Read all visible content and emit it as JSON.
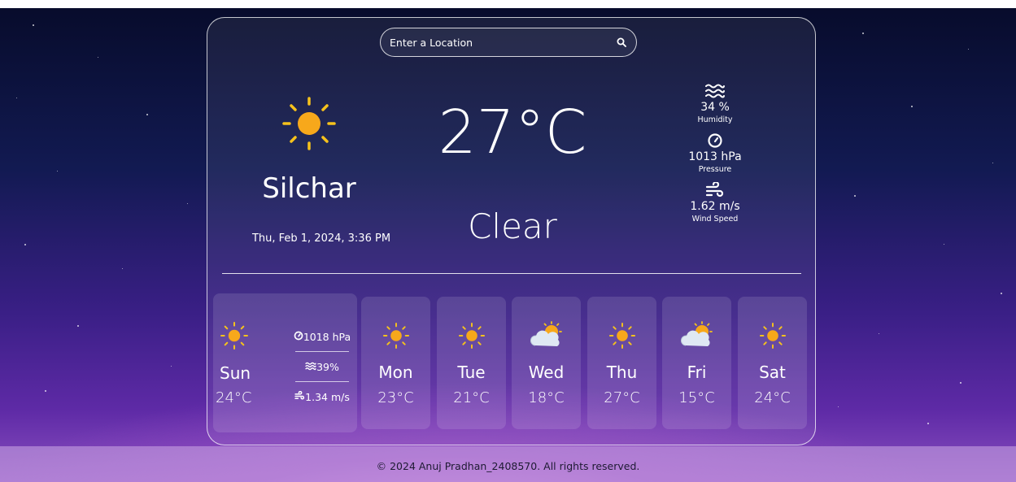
{
  "search": {
    "placeholder": "Enter a Location"
  },
  "current": {
    "city": "Silchar",
    "datetime": "Thu, Feb 1, 2024, 3:36 PM",
    "temperature": "27°C",
    "condition": "Clear",
    "icon": "sun-icon"
  },
  "stats": {
    "humidity": {
      "value": "34 %",
      "label": "Humidity",
      "icon": "humidity-icon"
    },
    "pressure": {
      "value": "1013 hPa",
      "label": "Pressure",
      "icon": "pressure-gauge-icon"
    },
    "wind": {
      "value": "1.62 m/s",
      "label": "Wind Speed",
      "icon": "wind-icon"
    }
  },
  "today": {
    "day": "Sun",
    "temp": "24°C",
    "pressure": "1018 hPa",
    "humidity": "39%",
    "wind": "1.34 m/s",
    "icon": "sun-icon"
  },
  "forecast": [
    {
      "day": "Mon",
      "temp": "23°C",
      "icon": "sun-icon"
    },
    {
      "day": "Tue",
      "temp": "21°C",
      "icon": "sun-icon"
    },
    {
      "day": "Wed",
      "temp": "18°C",
      "icon": "cloud-sun-icon"
    },
    {
      "day": "Thu",
      "temp": "27°C",
      "icon": "sun-icon"
    },
    {
      "day": "Fri",
      "temp": "15°C",
      "icon": "cloud-sun-icon"
    },
    {
      "day": "Sat",
      "temp": "24°C",
      "icon": "sun-icon"
    }
  ],
  "footer": {
    "text": "© 2024 Anuj Pradhan_2408570. All rights reserved."
  },
  "colors": {
    "sun": "#f7a81b",
    "sun_rays": "#f6c21c",
    "cloud": "#dfe8f3"
  }
}
